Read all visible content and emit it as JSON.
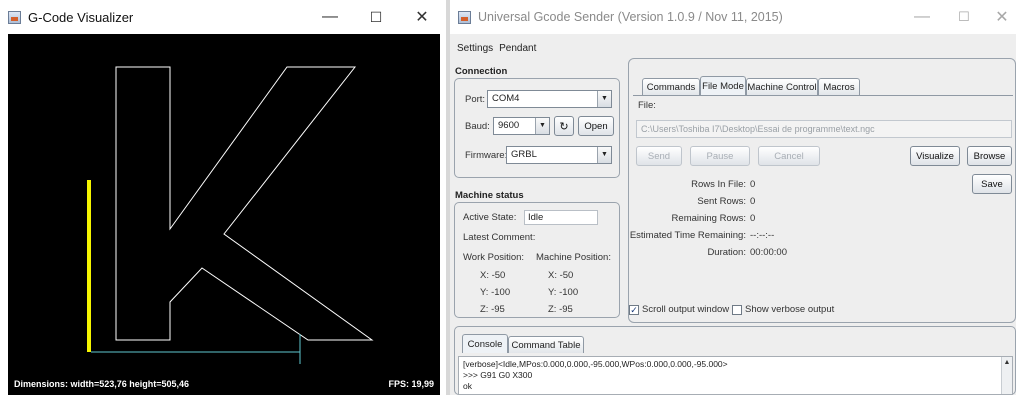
{
  "visualizer": {
    "title": "G-Code Visualizer",
    "controls": {
      "minimize": "—",
      "maximize": "☐",
      "close": "✕"
    },
    "dimensions": "Dimensions: width=523,76 height=505,46",
    "fps": "FPS: 19,99",
    "colors": {
      "background": "#000000",
      "toolpath": "#ffffff",
      "marker": "#f5f500",
      "travel": "#5fc8d0"
    }
  },
  "ugs": {
    "title": "Universal Gcode Sender (Version 1.0.9 / Nov 11, 2015)",
    "controls": {
      "minimize": "—",
      "maximize": "☐",
      "close": "✕"
    },
    "menu": [
      "Settings",
      "Pendant"
    ],
    "connection": {
      "title": "Connection",
      "port_label": "Port:",
      "port_value": "COM4",
      "baud_label": "Baud:",
      "baud_value": "9600",
      "refresh_icon": "refresh-icon",
      "open_label": "Open",
      "firmware_label": "Firmware:",
      "firmware_value": "GRBL"
    },
    "machine_status": {
      "title": "Machine status",
      "active_state_label": "Active State:",
      "active_state_value": "Idle",
      "latest_comment_label": "Latest Comment:",
      "work_position_label": "Work Position:",
      "machine_position_label": "Machine Position:",
      "work": {
        "x": "X:  -50",
        "y": "Y:  -100",
        "z": "Z:  -95"
      },
      "machine": {
        "x": "X:  -50",
        "y": "Y:  -100",
        "z": "Z:  -95"
      }
    },
    "tabs": [
      "Commands",
      "File Mode",
      "Machine Control",
      "Macros"
    ],
    "active_tab": "File Mode",
    "file": {
      "label": "File:",
      "path": "C:\\Users\\Toshiba I7\\Desktop\\Essai de programme\\text.ngc",
      "send": "Send",
      "pause": "Pause",
      "cancel": "Cancel",
      "visualize": "Visualize",
      "browse": "Browse",
      "save": "Save"
    },
    "stats": {
      "rows_in_file_label": "Rows In File:",
      "rows_in_file": "0",
      "sent_rows_label": "Sent Rows:",
      "sent_rows": "0",
      "remaining_rows_label": "Remaining Rows:",
      "remaining_rows": "0",
      "estimated_time_label": "Estimated Time Remaining:",
      "estimated_time": "--:--:--",
      "duration_label": "Duration:",
      "duration": "00:00:00"
    },
    "options": {
      "scroll_output": {
        "label": "Scroll output window",
        "checked": true
      },
      "verbose_output": {
        "label": "Show verbose output",
        "checked": false
      }
    },
    "console_tabs": [
      "Console",
      "Command Table"
    ],
    "console_lines": [
      "[verbose]<Idle,MPos:0.000,0.000,-95.000,WPos:0.000,0.000,-95.000>",
      ">>> G91 G0  X300",
      "ok"
    ]
  }
}
